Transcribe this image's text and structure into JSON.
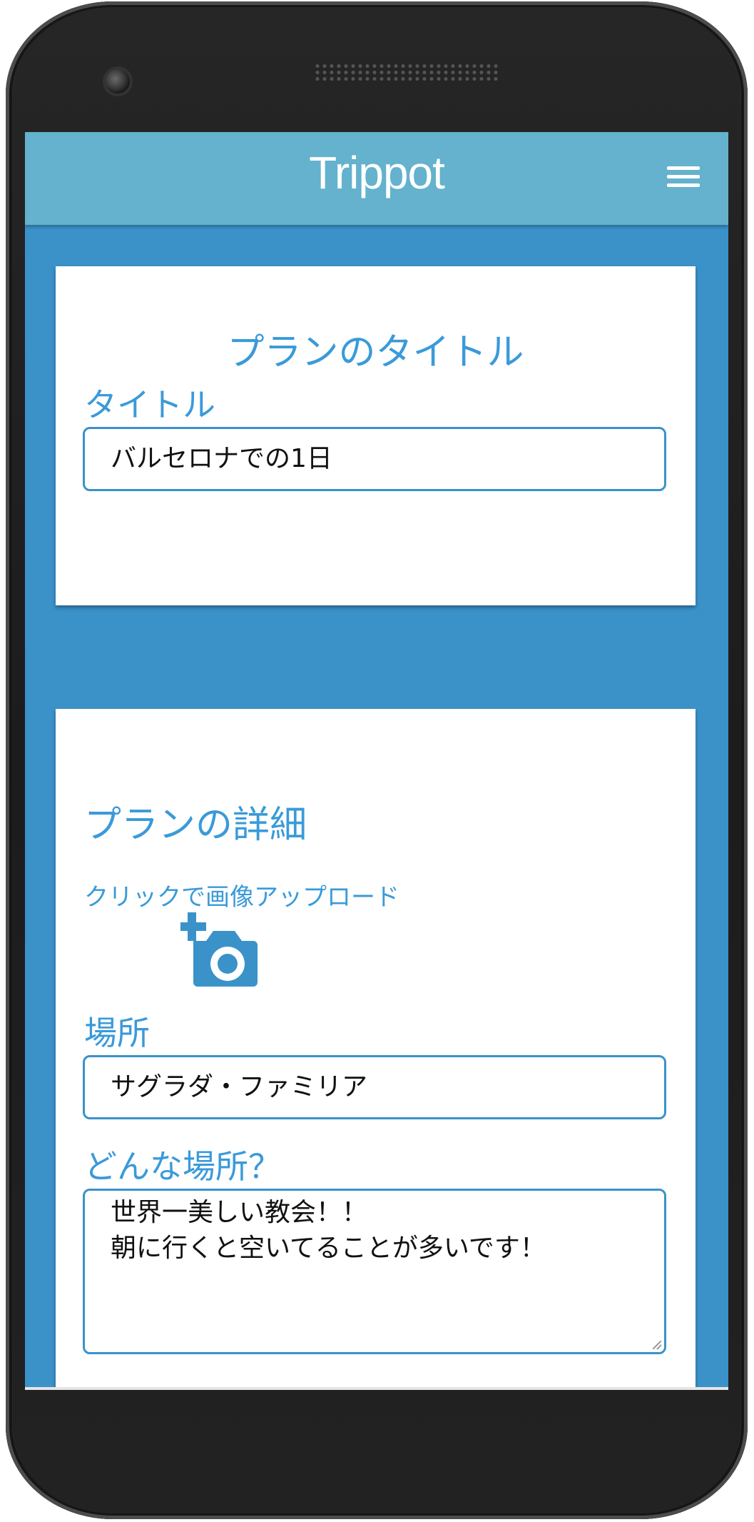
{
  "app": {
    "title": "Trippot",
    "menu_icon": "hamburger-menu-icon"
  },
  "title_card": {
    "heading": "プランのタイトル",
    "title_label": "タイトル",
    "title_value": "バルセロナでの1日"
  },
  "detail_card": {
    "heading": "プランの詳細",
    "upload_label": "クリックで画像アップロード",
    "upload_icon": "add-photo-camera-icon",
    "place_label": "場所",
    "place_value": "サグラダ・ファミリア",
    "description_label": "どんな場所？",
    "description_lines": [
      "世界一美しい教会！！",
      "朝に行くと空いてることが多いです！"
    ]
  },
  "colors": {
    "header": "#64b2cd",
    "background": "#3a92c9",
    "accent_text": "#3a9ad9"
  }
}
